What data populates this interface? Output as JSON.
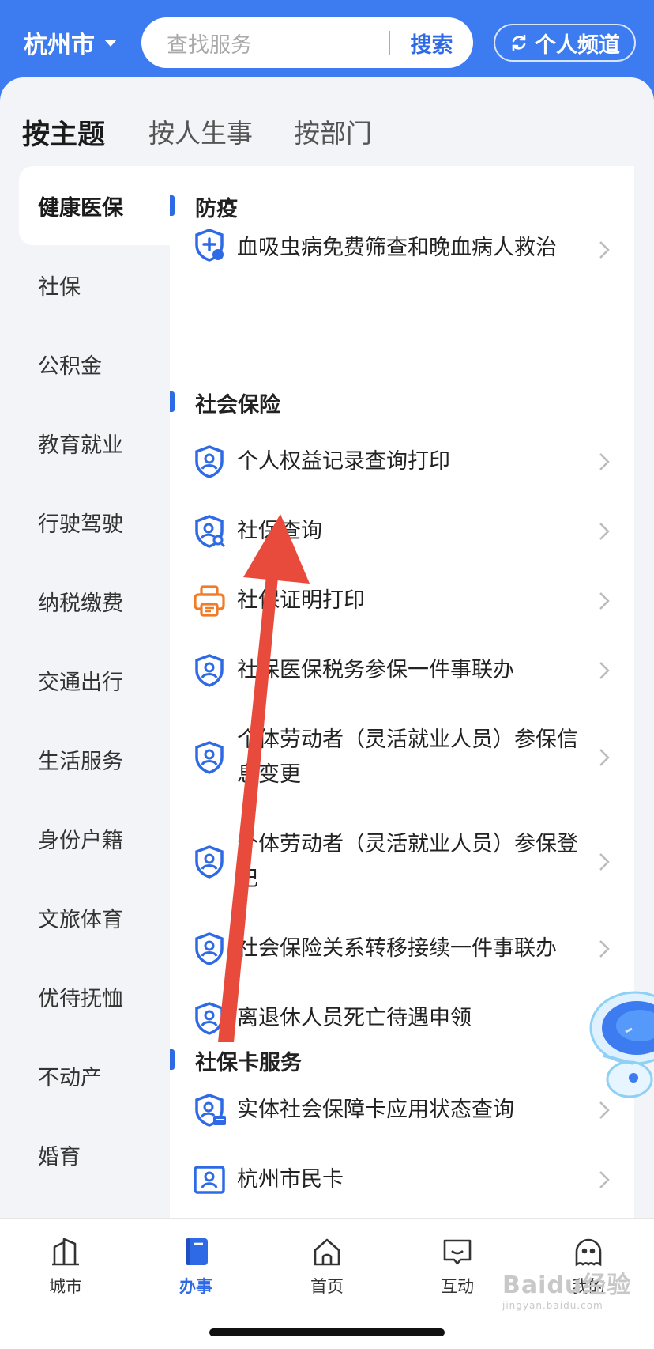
{
  "header": {
    "city": "杭州市",
    "search_placeholder": "查找服务",
    "search_button": "搜索",
    "channel_label": "个人频道"
  },
  "tabs": [
    {
      "label": "按主题",
      "active": true
    },
    {
      "label": "按人生事",
      "active": false
    },
    {
      "label": "按部门",
      "active": false
    }
  ],
  "sidebar": {
    "items": [
      {
        "label": "健康医保",
        "active": true
      },
      {
        "label": "社保"
      },
      {
        "label": "公积金"
      },
      {
        "label": "教育就业"
      },
      {
        "label": "行驶驾驶"
      },
      {
        "label": "纳税缴费"
      },
      {
        "label": "交通出行"
      },
      {
        "label": "生活服务"
      },
      {
        "label": "身份户籍"
      },
      {
        "label": "文旅体育"
      },
      {
        "label": "优待抚恤"
      },
      {
        "label": "不动产"
      },
      {
        "label": "婚育"
      }
    ]
  },
  "sections": [
    {
      "title": "防疫",
      "items": [
        {
          "label": "血吸虫病免费筛查和晚血病人救治",
          "icon": "shield-plus-icon"
        }
      ]
    },
    {
      "title": "社会保险",
      "items": [
        {
          "label": "个人权益记录查询打印",
          "icon": "shield-user-icon"
        },
        {
          "label": "社保查询",
          "icon": "shield-search-icon"
        },
        {
          "label": "社保证明打印",
          "icon": "printer-icon"
        },
        {
          "label": "社保医保税务参保一件事联办",
          "icon": "shield-user-icon"
        },
        {
          "label": "个体劳动者（灵活就业人员）参保信息变更",
          "icon": "shield-user-icon"
        },
        {
          "label": "个体劳动者（灵活就业人员）参保登记",
          "icon": "shield-user-icon"
        },
        {
          "label": "社会保险关系转移接续一件事联办",
          "icon": "shield-user-icon"
        },
        {
          "label": "离退休人员死亡待遇申领",
          "icon": "shield-user-icon"
        }
      ]
    },
    {
      "title": "社保卡服务",
      "items": [
        {
          "label": "实体社会保障卡应用状态查询",
          "icon": "shield-card-icon"
        },
        {
          "label": "杭州市民卡",
          "icon": "id-card-icon"
        }
      ]
    }
  ],
  "bottom_nav": [
    {
      "label": "城市",
      "icon": "city-icon"
    },
    {
      "label": "办事",
      "icon": "book-icon",
      "active": true
    },
    {
      "label": "首页",
      "icon": "home-icon"
    },
    {
      "label": "互动",
      "icon": "chat-icon"
    },
    {
      "label": "我的",
      "icon": "profile-icon"
    }
  ],
  "watermark": {
    "main": "Baidu经验",
    "sub": "jingyan.baidu.com"
  },
  "colors": {
    "brand": "#3d7bf0",
    "accent": "#2f6ae6",
    "annotation_arrow": "#e84b3c",
    "printer": "#f07c2a"
  }
}
